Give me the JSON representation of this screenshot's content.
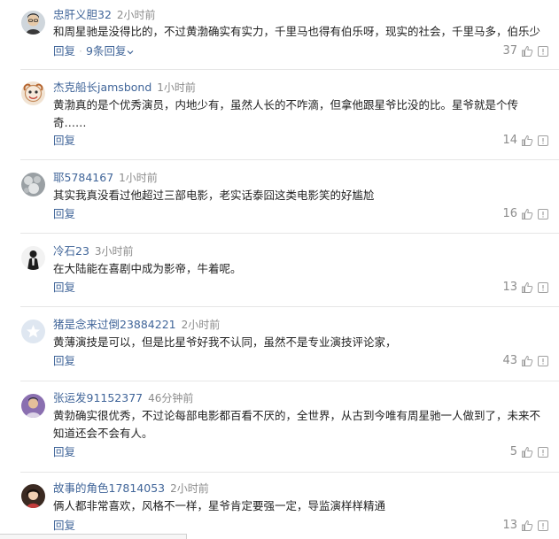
{
  "comments": [
    {
      "username": "忠肝义胆32",
      "time": "2小时前",
      "text": "和周星驰是没得比的，不过黄渤确实有实力，千里马也得有伯乐呀，现实的社会，千里马多，伯乐少",
      "reply_label": "回复",
      "replies_label": "9条回复",
      "likes": "37",
      "avatar": "avatar-man-glasses"
    },
    {
      "username": "杰克船长jamsbond",
      "time": "1小时前",
      "text": "黄渤真的是个优秀演员，内地少有，虽然人长的不咋滴，但拿他跟星爷比没的比。星爷就是个传奇……",
      "reply_label": "回复",
      "likes": "14",
      "avatar": "avatar-cartoon-face"
    },
    {
      "username": "耶5784167",
      "time": "1小时前",
      "text": "其实我真没看过他超过三部电影，老实话泰囧这类电影笑的好尴尬",
      "reply_label": "回复",
      "likes": "16",
      "avatar": "avatar-gray-photo"
    },
    {
      "username": "冷石23",
      "time": "3小时前",
      "text": "在大陆能在喜剧中成为影帝，牛着呢。",
      "reply_label": "回复",
      "likes": "13",
      "avatar": "avatar-dark-figure"
    },
    {
      "username": "猪是念来过倒23884221",
      "time": "2小时前",
      "text": "黄薄演技是可以，但是比星爷好我不认同，虽然不是专业演技评论家，",
      "reply_label": "回复",
      "likes": "43",
      "avatar": "avatar-default-star"
    },
    {
      "username": "张运发91152377",
      "time": "46分钟前",
      "text": "黄勃确实很优秀，不过论每部电影都百看不厌的，全世界，从古到今唯有周星驰一人做到了，未来不知道还会不会有人。",
      "reply_label": "回复",
      "likes": "5",
      "avatar": "avatar-portrait-purple"
    },
    {
      "username": "故事的角色17814053",
      "time": "2小时前",
      "text": "俩人都非常喜欢，风格不一样，星爷肯定要强一定，导监演样样精通",
      "reply_label": "回复",
      "likes": "13",
      "avatar": "avatar-girl-dark-hair"
    }
  ],
  "icons": {
    "like": "thumbs-up-icon",
    "report": "warning-icon",
    "expand": "chevron-down-icon"
  },
  "colors": {
    "link": "#406599",
    "muted": "#8c8c8c",
    "text": "#222222",
    "divider": "#e6e6e6"
  }
}
